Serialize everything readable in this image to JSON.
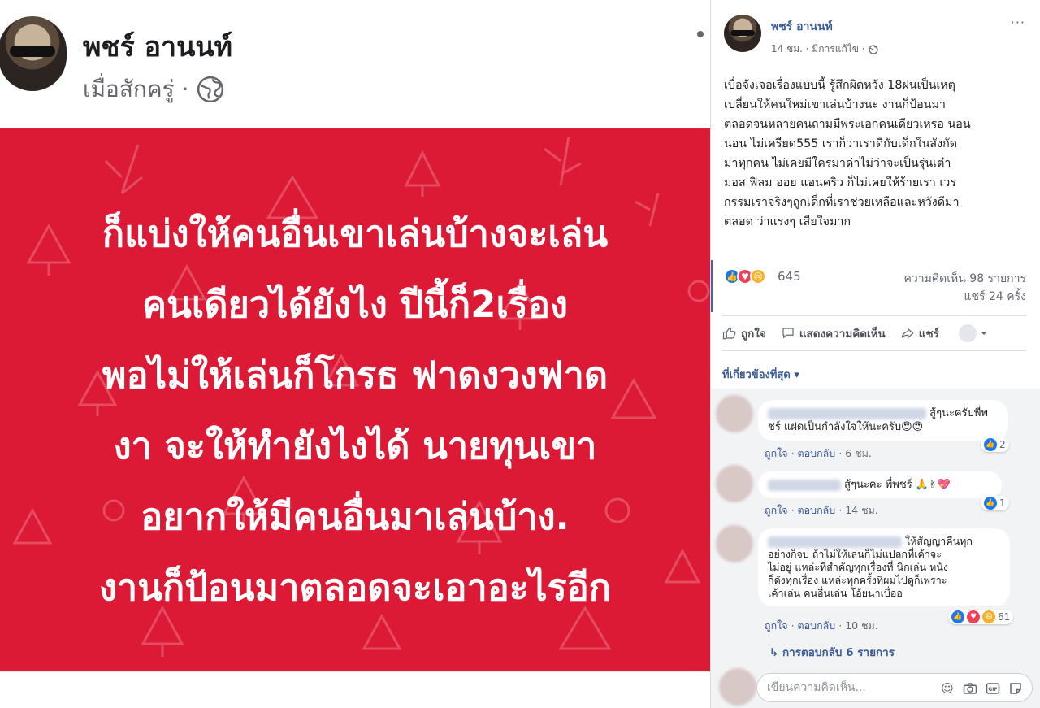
{
  "photo": {
    "author": "พชร์ อานนท์",
    "time": "เมื่อสักครู่ ·",
    "image_text_lines": [
      "ก็แบ่งให้คนอื่นเขาเล่นบ้างจะเล่น",
      "คนเดียวได้ยังไง ปีนี้ก็2เรื่อง",
      "พอไม่ให้เล่นก็โกรธ ฟาดงวงฟาด",
      "งา จะให้ทำยังไงได้ นายทุนเขา",
      "อยากให้มีคนอื่นมาเล่นบ้าง.",
      "งานก็ป้อนมาตลอดจะเอาอะไรอีก"
    ],
    "card_color": "#dd1a35"
  },
  "post": {
    "author": "พชร์ อานนท์",
    "time": "14 ชม. · มีการแก้ไข ·",
    "more": "···",
    "text": "เบื่อจังเจอเรื่องแบบนี้ รู้สึกผิดหวัง 18ฝนเป็นเหตุ\nเปลี่ยนให้คนใหม่เขาเล่นบ้างนะ งานก็ป้อนมา\nตลอดจนหลายคนถามมีพระเอกคนเดียวเหรอ นอน\nนอน ไม่เครียด555 เราก็ว่าเราดีกับเด็กในสังกัด\nมาทุกคน ไม่เคยมีใครมาด่าไม่ว่าจะเป็นรุ่นเต๋า\nมอส ฟิลม ออย แอนคริว ก็ไม่เคยให้ร้ายเรา เวร\nกรรมเราจริงๆถูกเด็กที่เราช่วยเหลือและหวังดีมา\nตลอด ว่าแรงๆ เสียใจมาก",
    "reaction_count": "645",
    "comments": "ความคิดเห็น 98 รายการ",
    "shares": "แชร์ 24 ครั้ง"
  },
  "actions": {
    "like": "ถูกใจ",
    "comment": "แสดงความคิดเห็น",
    "share": "แชร์"
  },
  "filter_label": "ที่เกี่ยวข้องที่สุด ▾",
  "comments": [
    {
      "text": "สู้ๆนะครับพี่พ",
      "text2": "ชร์ แฝดเป็นกำลังใจให้นะครับ😍😍",
      "like": "ถูกใจ",
      "reply": "ตอบกลับ",
      "time": "6 ชม.",
      "count": "2"
    },
    {
      "text": "สู้ๆนะคะ พี่พชร์ 🙏✌💖",
      "like": "ถูกใจ",
      "reply": "ตอบกลับ",
      "time": "14 ชม.",
      "count": "1"
    },
    {
      "text": "ให้สัญญาคืนทุก",
      "text2": "อย่างก็จบ ถ้าไม่ให้เล่นก็ไม่แปลกที่เค้าจะ",
      "text3": "ไม่อยู่ แหล่ะที่สำคัญทุกเรื่องที่ นิกเล่น หนัง",
      "text4": "ก็ดังทุกเรื่อง แหล่ะทุกครั้งที่ผมไปดูก็เพราะ",
      "text5": "เค้าเล่น คนอื่นเล่น โอ้ยน่าเบื่ออ",
      "like": "ถูกใจ",
      "reply": "ตอบกลับ",
      "time": "10 ชม.",
      "count": "61"
    }
  ],
  "replies_link": "↳  การตอบกลับ 6 รายการ",
  "composer": {
    "placeholder": "เขียนความคิดเห็น..."
  }
}
